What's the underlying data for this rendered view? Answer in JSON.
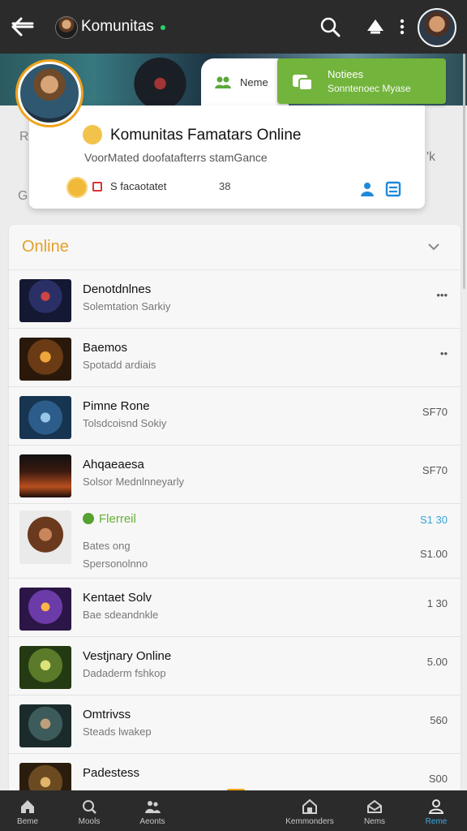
{
  "topbar": {
    "title": "Komunitas",
    "icons": [
      "back-arrow-icon",
      "search-icon",
      "notification-icon",
      "more-vertical-icon",
      "profile-avatar"
    ]
  },
  "header": {
    "tab_name": "Neme",
    "notice_title": "Notiees",
    "notice_subtitle": "Sonntenoec Myase"
  },
  "group": {
    "title": "Komunitas Famatars Online",
    "description": "VoorMated doofatafterrs stamGance",
    "stat_label": "S facaotatet",
    "stat_count": "38",
    "side_left": "R",
    "side_g": "G",
    "side_right": "'k"
  },
  "list": {
    "section_title": "Online",
    "rows": [
      {
        "title": "Denotdnlnes",
        "subtitle": "Solemtation Sarkiy",
        "right": "•••"
      },
      {
        "title": "Baemos",
        "subtitle": "Spotadd ardiais",
        "right": "••"
      },
      {
        "title": "Pimne Rone",
        "subtitle": "Tolsdcoisnd Sokiy",
        "right": "SF70"
      },
      {
        "title": "Ahqaeaesa",
        "subtitle": "Solsor Mednlnneyarly",
        "right": "SF70"
      },
      {
        "title": "Flerreil",
        "subtitle": "Bates ong",
        "subtitle2": "Spersonolnno",
        "right": "S1 30",
        "right2": "S1.00"
      },
      {
        "title": "Kentaet Solv",
        "subtitle": "Bae sdeandnkle",
        "right": "1 30"
      },
      {
        "title": "Vestjnary Online",
        "subtitle": "Dadaderm fshkop",
        "right": "5.00"
      },
      {
        "title": "Omtrivss",
        "subtitle": "Steads lwakep",
        "right": "560"
      },
      {
        "title": "Padestess",
        "subtitle": "",
        "right": "S00"
      }
    ]
  },
  "bottom_nav": {
    "items": [
      {
        "label": "Beme"
      },
      {
        "label": "Mools"
      },
      {
        "label": "Aeonts"
      },
      {
        "label": "Kemmonders"
      },
      {
        "label": "Nems"
      },
      {
        "label": "Reme"
      }
    ]
  },
  "colors": {
    "accent_green": "#73b43d",
    "accent_blue": "#1e89d8",
    "section_orange": "#e4a127"
  }
}
